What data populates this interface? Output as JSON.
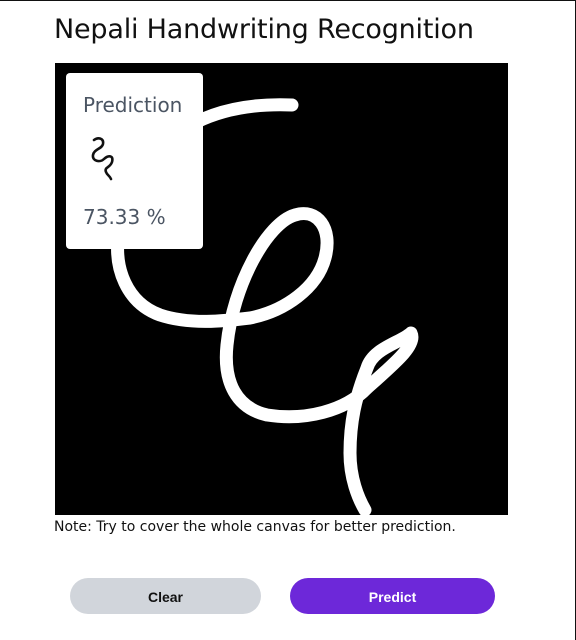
{
  "page": {
    "title": "Nepali Handwriting Recognition"
  },
  "prediction": {
    "label": "Prediction",
    "character": "ध",
    "confidence": "73.33 %"
  },
  "note": "Note: Try to cover the whole canvas for better prediction.",
  "buttons": {
    "clear_label": "Clear",
    "predict_label": "Predict"
  },
  "colors": {
    "canvas_background": "#000000",
    "stroke": "#ffffff",
    "predict_button": "#6d28d9",
    "clear_button": "#d1d5db"
  }
}
